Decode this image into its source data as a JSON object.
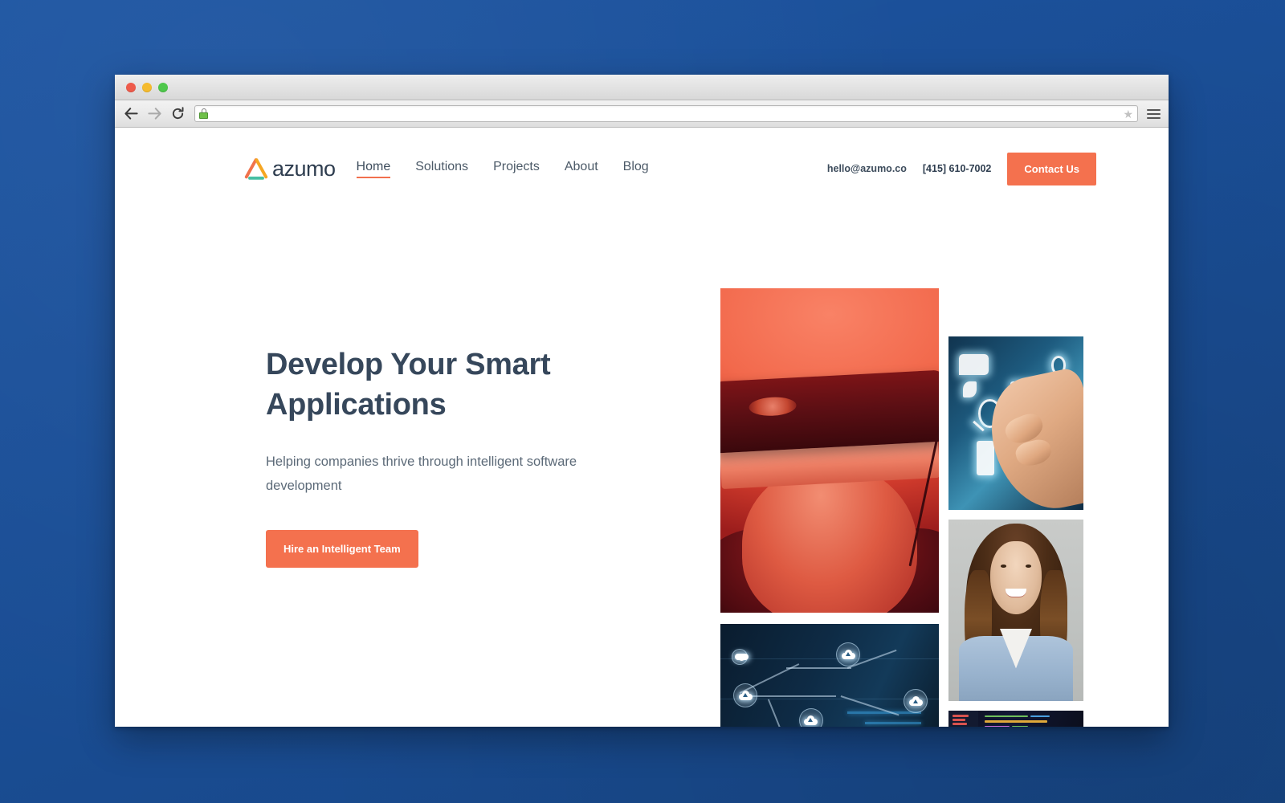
{
  "window": {
    "traffic_lights": [
      "close",
      "minimize",
      "maximize"
    ],
    "toolbar": {
      "back_icon": "back-arrow-icon",
      "forward_icon": "forward-arrow-icon",
      "reload_icon": "reload-icon",
      "lock_icon": "padlock-icon",
      "url_value": "",
      "url_placeholder": "",
      "bookmark_icon": "star-icon",
      "menu_icon": "hamburger-menu-icon"
    }
  },
  "site": {
    "brand": {
      "wordmark": "azumo",
      "mark_icon": "azumo-triangle-logo",
      "colors": {
        "left_stroke": "#F0724C",
        "right_stroke": "#F5A623",
        "base_bar": "#47BFA3"
      }
    },
    "nav": [
      {
        "label": "Home",
        "active": true
      },
      {
        "label": "Solutions",
        "active": false
      },
      {
        "label": "Projects",
        "active": false
      },
      {
        "label": "About",
        "active": false
      },
      {
        "label": "Blog",
        "active": false
      }
    ],
    "header_contact": {
      "email": "hello@azumo.co",
      "phone": "[415] 610-7002",
      "cta_label": "Contact Us"
    },
    "hero": {
      "title": "Develop Your Smart Applications",
      "subtitle": "Helping companies thrive through intelligent software development",
      "cta_label": "Hire an Intelligent Team"
    },
    "collage": [
      {
        "name": "vr-headset-photo",
        "alt": "Woman wearing a VR headset, red duotone"
      },
      {
        "name": "touch-tech-photo",
        "alt": "Hand touching glowing technology icons"
      },
      {
        "name": "team-portrait-photo",
        "alt": "Smiling woman with long brown hair in a light blue shirt"
      },
      {
        "name": "cloud-network-photo",
        "alt": "Cloud upload icons connected on a dark blue network"
      },
      {
        "name": "code-editor-photo",
        "alt": "Source code on a dark editor screen"
      }
    ],
    "colors": {
      "accent": "#F4714E",
      "heading": "#36475B",
      "body_text": "#5C6A78",
      "desktop_background": "#1B4F95"
    }
  }
}
